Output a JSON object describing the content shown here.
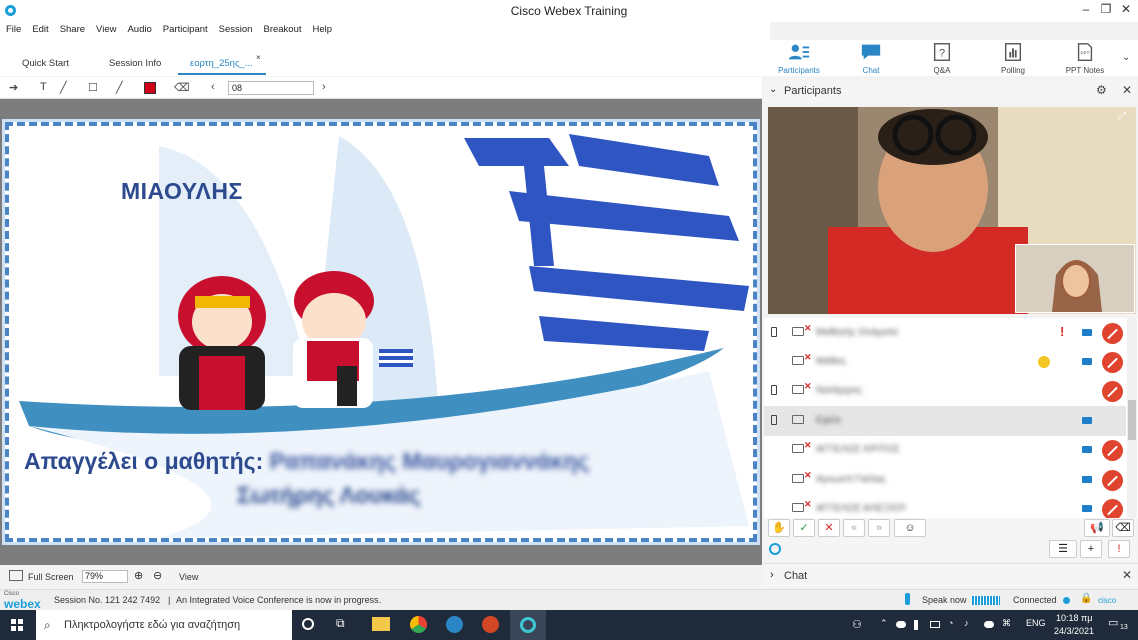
{
  "window": {
    "title": "Cisco Webex Training"
  },
  "menu": [
    "File",
    "Edit",
    "Share",
    "View",
    "Audio",
    "Participant",
    "Session",
    "Breakout",
    "Help"
  ],
  "doc_tabs": [
    {
      "label": "Quick Start"
    },
    {
      "label": "Session Info"
    },
    {
      "label": "εορτη_25ης_...",
      "close": "×"
    }
  ],
  "panel_tabs": [
    {
      "label": "Participants",
      "icon": "participants-icon"
    },
    {
      "label": "Chat",
      "icon": "chat-icon"
    },
    {
      "label": "Q&A",
      "icon": "qa-icon"
    },
    {
      "label": "Polling",
      "icon": "polling-icon"
    },
    {
      "label": "PPT Notes",
      "icon": "ppt-notes-icon"
    }
  ],
  "toolbar": {
    "page_value": "08"
  },
  "slide": {
    "title": "ΜΙΑΟΥΛΗΣ",
    "caption_static": "Απαγγέλει ο μαθητής:",
    "caption_name1": "Ραπανάκης Μαυρογιαννάκης",
    "caption_name2": "Σωτήρης Λουκάς"
  },
  "status": {
    "full_screen": "Full Screen",
    "zoom": "79%",
    "view": "View"
  },
  "session": {
    "brand": "webex",
    "brand_small": "Cisco",
    "session_no": "Session No. 121 242 7492",
    "audio_msg": "An Integrated Voice Conference is now in progress.",
    "speak_now": "Speak now",
    "connected": "Connected",
    "cisco_logo": "cisco"
  },
  "participants_panel": {
    "title": "Participants",
    "rows": [
      {
        "name": "Μαθητής Ονόματα",
        "device": true,
        "raised": true,
        "camera": true
      },
      {
        "name": "Μάθος",
        "device": false,
        "emoji": true,
        "camera": true
      },
      {
        "name": "Νατάρχιος",
        "device": true,
        "camera": false
      },
      {
        "name": "Εφέλι",
        "device": true,
        "camera": true,
        "selected": true
      },
      {
        "name": "ΑΓΓΕΛΟΣ ΚΡΙΤΟΣ",
        "device": false,
        "camera": true
      },
      {
        "name": "Αγνωστί Γκέλας",
        "device": false,
        "camera": true
      },
      {
        "name": "ΑΓΓΕΛΟΣ ΑΛΕΞΙΟΥ",
        "device": false,
        "camera": true
      }
    ]
  },
  "chat_panel": {
    "title": "Chat"
  },
  "taskbar": {
    "search_placeholder": "Πληκτρολογήστε εδώ για αναζήτηση",
    "lang": "ENG",
    "time": "10:18 πμ",
    "date": "24/3/2021",
    "notifications": "13"
  }
}
